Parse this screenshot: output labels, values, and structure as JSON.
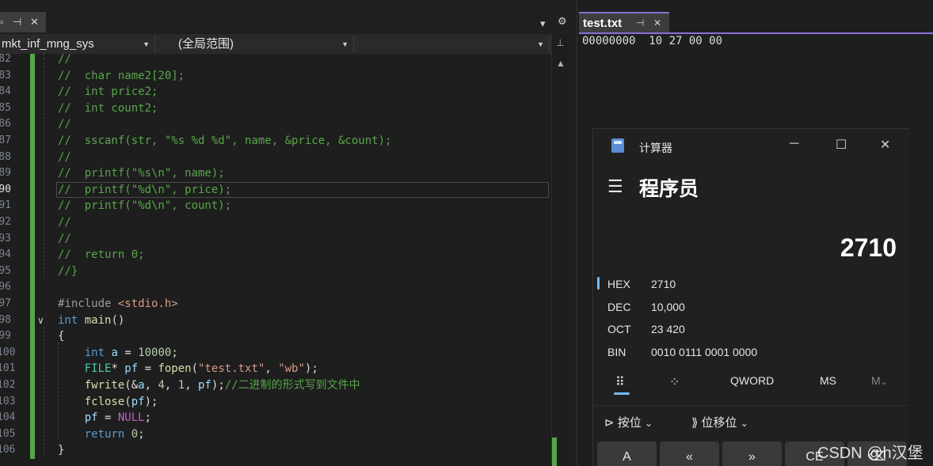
{
  "editor": {
    "nav": {
      "scope_project": "mkt_inf_mng_sys",
      "scope_global": "(全局范围)",
      "scope_member": ""
    },
    "lines": [
      {
        "n": "82",
        "parts": [
          {
            "t": "//",
            "c": "cm"
          }
        ]
      },
      {
        "n": "83",
        "parts": [
          {
            "t": "//  char name2[20];",
            "c": "cm"
          }
        ]
      },
      {
        "n": "84",
        "parts": [
          {
            "t": "//  int price2;",
            "c": "cm"
          }
        ]
      },
      {
        "n": "85",
        "parts": [
          {
            "t": "//  int count2;",
            "c": "cm"
          }
        ]
      },
      {
        "n": "86",
        "parts": [
          {
            "t": "//",
            "c": "cm"
          }
        ]
      },
      {
        "n": "87",
        "parts": [
          {
            "t": "//  sscanf(str, \"%s %d %d\", name, &price, &count);",
            "c": "cm"
          }
        ]
      },
      {
        "n": "88",
        "parts": [
          {
            "t": "//",
            "c": "cm"
          }
        ]
      },
      {
        "n": "89",
        "parts": [
          {
            "t": "//  printf(\"%s\\n\", name);",
            "c": "cm"
          }
        ]
      },
      {
        "n": "90",
        "parts": [
          {
            "t": "//  printf(\"%d\\n\", price);",
            "c": "cm"
          }
        ],
        "current": true
      },
      {
        "n": "91",
        "parts": [
          {
            "t": "//  printf(\"%d\\n\", count);",
            "c": "cm"
          }
        ]
      },
      {
        "n": "92",
        "parts": [
          {
            "t": "//",
            "c": "cm"
          }
        ]
      },
      {
        "n": "93",
        "parts": [
          {
            "t": "//",
            "c": "cm"
          }
        ]
      },
      {
        "n": "94",
        "parts": [
          {
            "t": "//  return 0;",
            "c": "cm"
          }
        ]
      },
      {
        "n": "95",
        "parts": [
          {
            "t": "//}",
            "c": "cm"
          }
        ]
      },
      {
        "n": "96",
        "parts": []
      },
      {
        "n": "97",
        "parts": [
          {
            "t": "#include ",
            "c": "pp"
          },
          {
            "t": "<stdio.h>",
            "c": "st"
          }
        ]
      },
      {
        "n": "98",
        "parts": [
          {
            "t": "int",
            "c": "kw"
          },
          {
            "t": " ",
            "c": ""
          },
          {
            "t": "main",
            "c": "fn"
          },
          {
            "t": "()",
            "c": ""
          }
        ],
        "fold": true
      },
      {
        "n": "99",
        "parts": [
          {
            "t": "{",
            "c": ""
          }
        ]
      },
      {
        "n": "100",
        "parts": [
          {
            "t": "    ",
            "c": ""
          },
          {
            "t": "int",
            "c": "kw"
          },
          {
            "t": " ",
            "c": ""
          },
          {
            "t": "a",
            "c": "var"
          },
          {
            "t": " = ",
            "c": ""
          },
          {
            "t": "10000",
            "c": "num"
          },
          {
            "t": ";",
            "c": ""
          }
        ]
      },
      {
        "n": "101",
        "parts": [
          {
            "t": "    ",
            "c": ""
          },
          {
            "t": "FILE",
            "c": "ty"
          },
          {
            "t": "* ",
            "c": ""
          },
          {
            "t": "pf",
            "c": "var"
          },
          {
            "t": " = ",
            "c": ""
          },
          {
            "t": "fopen",
            "c": "fn"
          },
          {
            "t": "(",
            "c": ""
          },
          {
            "t": "\"test.txt\"",
            "c": "st"
          },
          {
            "t": ", ",
            "c": ""
          },
          {
            "t": "\"wb\"",
            "c": "st"
          },
          {
            "t": ");",
            "c": ""
          }
        ]
      },
      {
        "n": "102",
        "parts": [
          {
            "t": "    ",
            "c": ""
          },
          {
            "t": "fwrite",
            "c": "fn"
          },
          {
            "t": "(&",
            "c": ""
          },
          {
            "t": "a",
            "c": "var"
          },
          {
            "t": ", ",
            "c": ""
          },
          {
            "t": "4",
            "c": "num"
          },
          {
            "t": ", ",
            "c": ""
          },
          {
            "t": "1",
            "c": "num"
          },
          {
            "t": ", ",
            "c": ""
          },
          {
            "t": "pf",
            "c": "var"
          },
          {
            "t": ");",
            "c": ""
          },
          {
            "t": "//二进制的形式写到文件中",
            "c": "cm"
          }
        ]
      },
      {
        "n": "103",
        "parts": [
          {
            "t": "    ",
            "c": ""
          },
          {
            "t": "fclose",
            "c": "fn"
          },
          {
            "t": "(",
            "c": ""
          },
          {
            "t": "pf",
            "c": "var"
          },
          {
            "t": ");",
            "c": ""
          }
        ]
      },
      {
        "n": "104",
        "parts": [
          {
            "t": "    ",
            "c": ""
          },
          {
            "t": "pf",
            "c": "var"
          },
          {
            "t": " = ",
            "c": ""
          },
          {
            "t": "NULL",
            "c": "mac"
          },
          {
            "t": ";",
            "c": ""
          }
        ]
      },
      {
        "n": "105",
        "parts": [
          {
            "t": "    ",
            "c": ""
          },
          {
            "t": "return",
            "c": "kw"
          },
          {
            "t": " ",
            "c": ""
          },
          {
            "t": "0",
            "c": "num"
          },
          {
            "t": ";",
            "c": ""
          }
        ]
      },
      {
        "n": "106",
        "parts": [
          {
            "t": "}",
            "c": ""
          }
        ]
      }
    ]
  },
  "hex": {
    "tab_label": "test.txt",
    "row_offset": "00000000",
    "row_bytes": "10 27 00 00"
  },
  "calculator": {
    "title": "计算器",
    "mode": "程序员",
    "display": "2710",
    "radix": [
      {
        "label": "HEX",
        "value": "2710",
        "active": true
      },
      {
        "label": "DEC",
        "value": "10,000"
      },
      {
        "label": "OCT",
        "value": "23 420"
      },
      {
        "label": "BIN",
        "value": "0010 0111 0001 0000"
      }
    ],
    "word_size": "QWORD",
    "memory_store": "MS",
    "memory_more": "M",
    "bitwise_menu": "按位",
    "bitshift_menu": "位移位",
    "keys": [
      "A",
      "«",
      "»",
      "CE",
      "⌫"
    ]
  },
  "watermark": "CSDN @h汉堡"
}
